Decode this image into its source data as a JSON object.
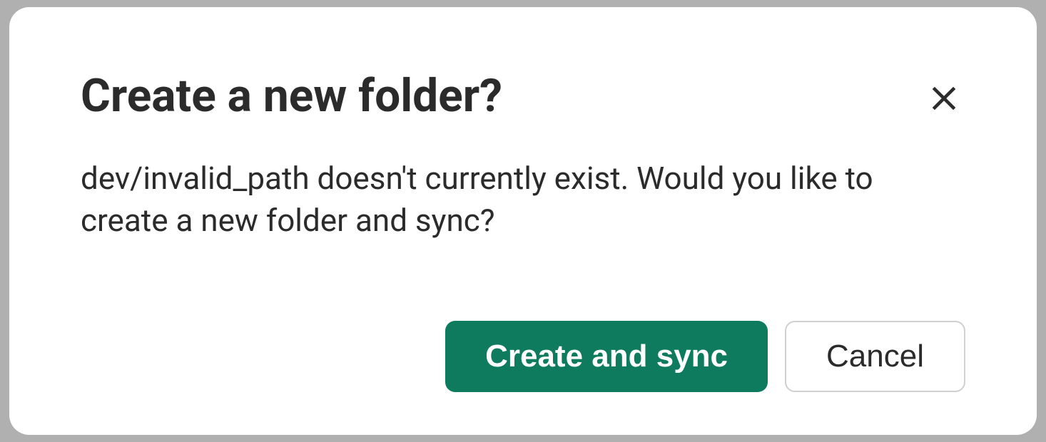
{
  "dialog": {
    "title": "Create a new folder?",
    "message": "dev/invalid_path doesn't currently exist. Would you like to create a new folder and sync?",
    "actions": {
      "primary": "Create and sync",
      "secondary": "Cancel"
    },
    "colors": {
      "primary": "#0e7b5f"
    }
  }
}
